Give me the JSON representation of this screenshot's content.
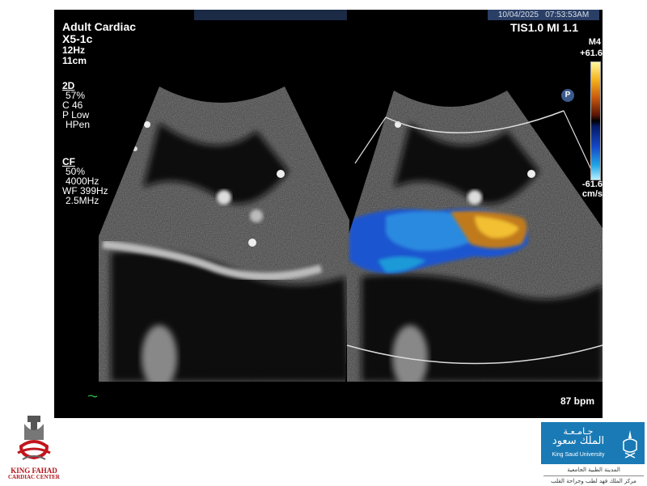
{
  "header": {
    "datetime": "10/04/2025   07:53:53AM",
    "tis_mi": "TIS1.0  MI 1.1"
  },
  "params": {
    "preset": "Adult Cardiac",
    "probe": "X5-1c",
    "frame_rate": "12Hz",
    "depth": "11cm"
  },
  "mode_2d": {
    "header": "2D",
    "lines": [
      "57%",
      "C 46",
      "P Low",
      "HPen"
    ]
  },
  "mode_cf": {
    "header": "CF",
    "lines": [
      "50%",
      "4000Hz",
      "WF 399Hz",
      "2.5MHz"
    ]
  },
  "color_scale": {
    "map": "M4",
    "top": "+61.6",
    "bottom": "-61.6",
    "unit": "cm/s",
    "colors": [
      "#fff7a0",
      "#f4b21c",
      "#c85a10",
      "#000000",
      "#1448c8",
      "#22a6e6",
      "#b8f0ff"
    ]
  },
  "p_badge": "P",
  "heart_rate": "87 bpm",
  "logos": {
    "kfcc_line1": "KING FAHAD",
    "kfcc_line2": "CARDIAC CENTER",
    "ksu_arabic_1": "جـامـعـة",
    "ksu_arabic_2": "الملك سعود",
    "ksu_english": "King Saud University",
    "ksu_sub_1": "المدينة الطبية الجامعية",
    "ksu_sub_2": "مركز الملك فهد لطب وجراحة القلب"
  }
}
